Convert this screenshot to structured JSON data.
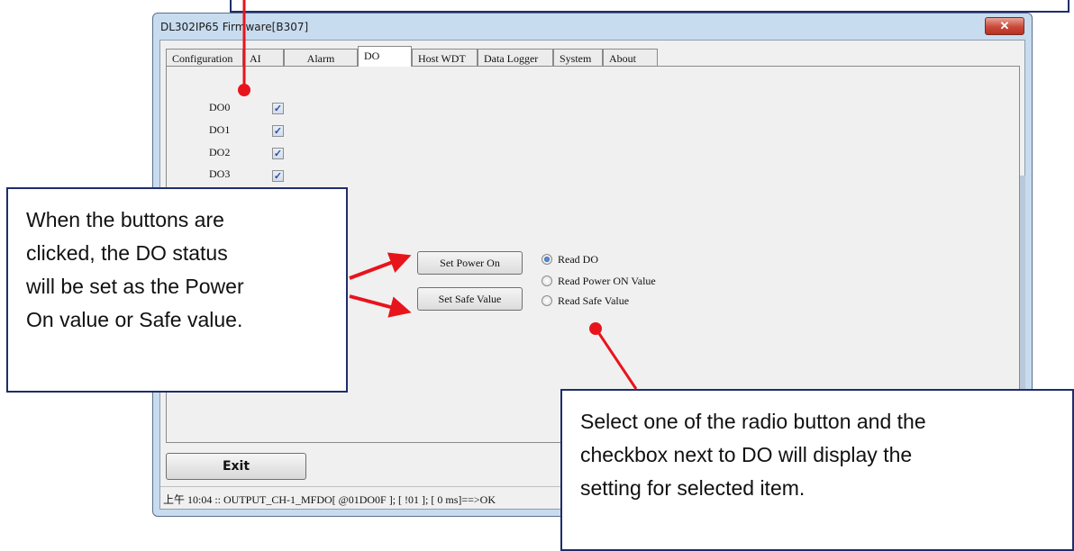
{
  "window": {
    "title": "DL302IP65 Firmware[B307]",
    "close_glyph": "✕"
  },
  "tabs": [
    {
      "label": "Configuration"
    },
    {
      "label": "AI"
    },
    {
      "label": "Alarm"
    },
    {
      "label": "DO",
      "active": true
    },
    {
      "label": "Host WDT"
    },
    {
      "label": "Data Logger"
    },
    {
      "label": "System"
    },
    {
      "label": "About"
    }
  ],
  "do_channels": [
    {
      "label": "DO0",
      "checked": true
    },
    {
      "label": "DO1",
      "checked": true
    },
    {
      "label": "DO2",
      "checked": true
    },
    {
      "label": "DO3",
      "checked": true
    }
  ],
  "buttons": {
    "set_power_on": "Set Power On",
    "set_safe_value": "Set Safe Value",
    "exit": "Exit"
  },
  "radios": [
    {
      "label": "Read DO",
      "checked": true
    },
    {
      "label": "Read Power ON Value",
      "checked": false
    },
    {
      "label": "Read Safe Value",
      "checked": false
    }
  ],
  "status_bar": {
    "text": "上午 10:04 :: OUTPUT_CH-1_MFDO[ @01DO0F ]; [ !01 ]; [ 0 ms]==>OK"
  },
  "callouts": {
    "buttons_note": "When the buttons are\nclicked, the DO status\nwill be set as the Power\nOn value or Safe value.",
    "radio_note": "Select one of the radio button and the\ncheckbox next to DO will display the\nsetting for selected item."
  },
  "colors": {
    "annotation_arrow": "#e8141c",
    "callout_border": "#1f2d6b",
    "window_frame": "#c8dcf0"
  },
  "icons": {
    "checkbox": "check-icon",
    "close": "close-icon"
  }
}
